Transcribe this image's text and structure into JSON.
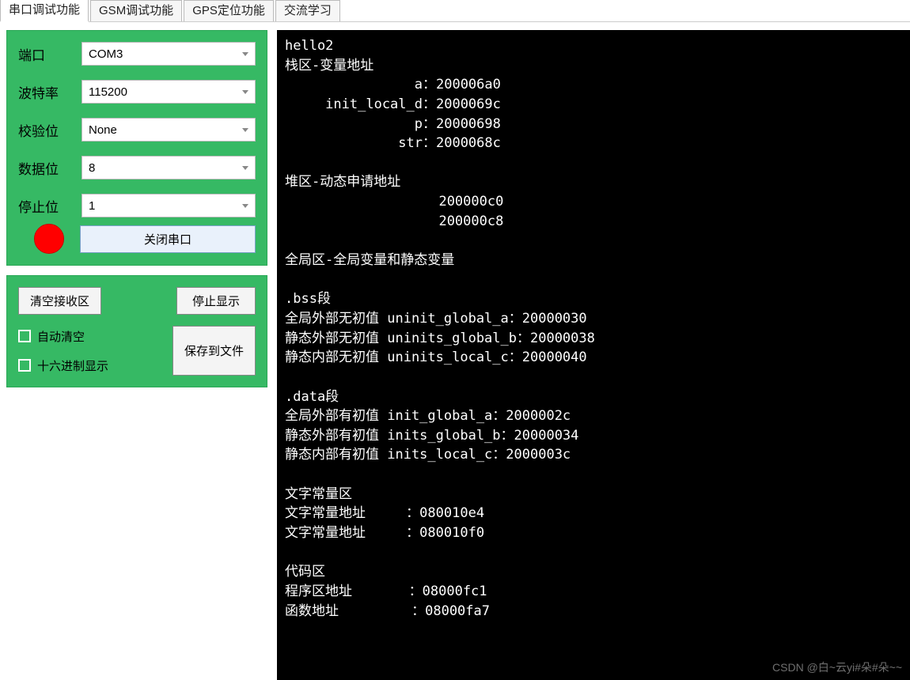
{
  "tabs": [
    {
      "label": "串口调试功能",
      "active": true
    },
    {
      "label": "GSM调试功能",
      "active": false
    },
    {
      "label": "GPS定位功能",
      "active": false
    },
    {
      "label": "交流学习",
      "active": false
    }
  ],
  "serial_config": {
    "port_label": "端口",
    "port_value": "COM3",
    "baud_label": "波特率",
    "baud_value": "115200",
    "parity_label": "校验位",
    "parity_value": "None",
    "databits_label": "数据位",
    "databits_value": "8",
    "stopbits_label": "停止位",
    "stopbits_value": "1",
    "status_color": "#ff0000",
    "close_button": "关闭串口"
  },
  "rx_panel": {
    "clear_button": "清空接收区",
    "stop_button": "停止显示",
    "auto_clear_label": "自动清空",
    "hex_display_label": "十六进制显示",
    "save_button": "保存到文件"
  },
  "terminal_lines": [
    "hello2",
    "栈区-变量地址",
    "                a：200006a0",
    "     init_local_d：2000069c",
    "                p：20000698",
    "              str：2000068c",
    "",
    "堆区-动态申请地址",
    "                   200000c0",
    "                   200000c8",
    "",
    "全局区-全局变量和静态变量",
    "",
    ".bss段",
    "全局外部无初值 uninit_global_a：20000030",
    "静态外部无初值 uninits_global_b：20000038",
    "静态内部无初值 uninits_local_c：20000040",
    "",
    ".data段",
    "全局外部有初值 init_global_a：2000002c",
    "静态外部有初值 inits_global_b：20000034",
    "静态内部有初值 inits_local_c：2000003c",
    "",
    "文字常量区",
    "文字常量地址     ：080010e4",
    "文字常量地址     ：080010f0",
    "",
    "代码区",
    "程序区地址       ：08000fc1",
    "函数地址         ：08000fa7"
  ],
  "watermark": "CSDN @白~云yi#朵#朵~~"
}
